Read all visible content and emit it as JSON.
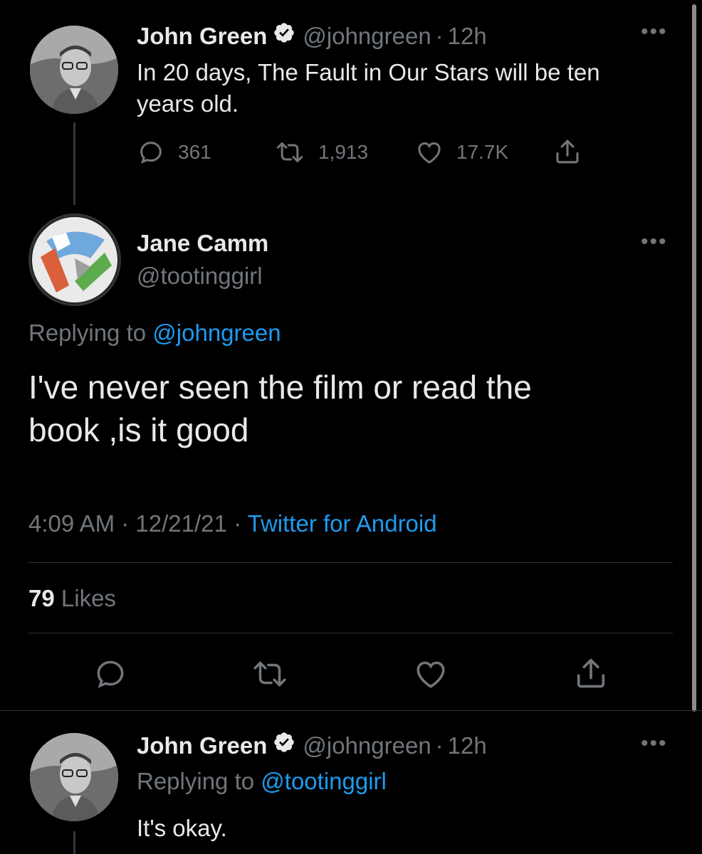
{
  "colors": {
    "background": "#000000",
    "text": "#e7e9ea",
    "muted": "#71767b",
    "link": "#1d9bf0",
    "divider": "#2f3336"
  },
  "tweet1": {
    "name": "John Green",
    "handle": "@johngreen",
    "dot": "·",
    "time": "12h",
    "text_line1": "In 20 days, The Fault in Our Stars will be ten",
    "text_line2": "years old.",
    "replies": "361",
    "retweets": "1,913",
    "likes": "17.7K",
    "icons": [
      "verified-badge-icon",
      "reply-icon",
      "retweet-icon",
      "like-icon",
      "share-icon",
      "more-icon"
    ]
  },
  "main_tweet": {
    "name": "Jane Camm",
    "handle": "@tootinggirl",
    "replying_prefix": "Replying to",
    "replying_to": "@johngreen",
    "text_line1": "I've never seen the film or read the",
    "text_line2": "book ,is it good",
    "time": "4:09 AM",
    "dot": "·",
    "date": "12/21/21",
    "source": "Twitter for Android",
    "likes_count": "79",
    "likes_label": "Likes",
    "icons": [
      "reply-icon",
      "retweet-icon",
      "like-icon",
      "share-icon",
      "more-icon"
    ]
  },
  "reply_tweet": {
    "name": "John Green",
    "handle": "@johngreen",
    "dot": "·",
    "time": "12h",
    "replying_prefix": "Replying to",
    "replying_to": "@tootinggirl",
    "text": "It's okay."
  }
}
